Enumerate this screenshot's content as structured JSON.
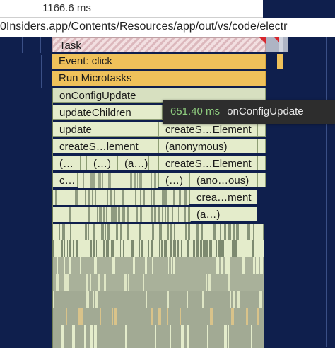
{
  "header": {
    "time_label": "1166.6 ms"
  },
  "url_strip": {
    "text": "0Insiders.app/Contents/Resources/app/out/vs/code/electr"
  },
  "flame": {
    "task": "Task",
    "event_click": "Event: click",
    "run_microtasks": "Run Microtasks",
    "on_config_update": "onConfigUpdate",
    "update_children": "updateChildren",
    "update": "update",
    "create_element_right_1": "createS…Element",
    "create_element_left": "createS…lement",
    "anonymous_1": "(anonymous)",
    "row7_a": "(…",
    "row7_b": "(…)",
    "row7_c": "(a…)",
    "create_element_right_2": "createS…Element",
    "row8_c": "c…",
    "row8_dots": "(…)",
    "anonymous_short": "(ano…ous)",
    "crea_ment": "crea…ment",
    "a_short": "(a…)"
  },
  "tooltip": {
    "duration": "651.40 ms",
    "name": "onConfigUpdate"
  },
  "colors": {
    "background": "#0f1f4d",
    "task_red": "#d7262e",
    "event_yellow": "#efc15a",
    "function_green": "#e4eccb",
    "tooltip_bg": "#2d2d2d",
    "duration_green": "#8fce7f"
  }
}
